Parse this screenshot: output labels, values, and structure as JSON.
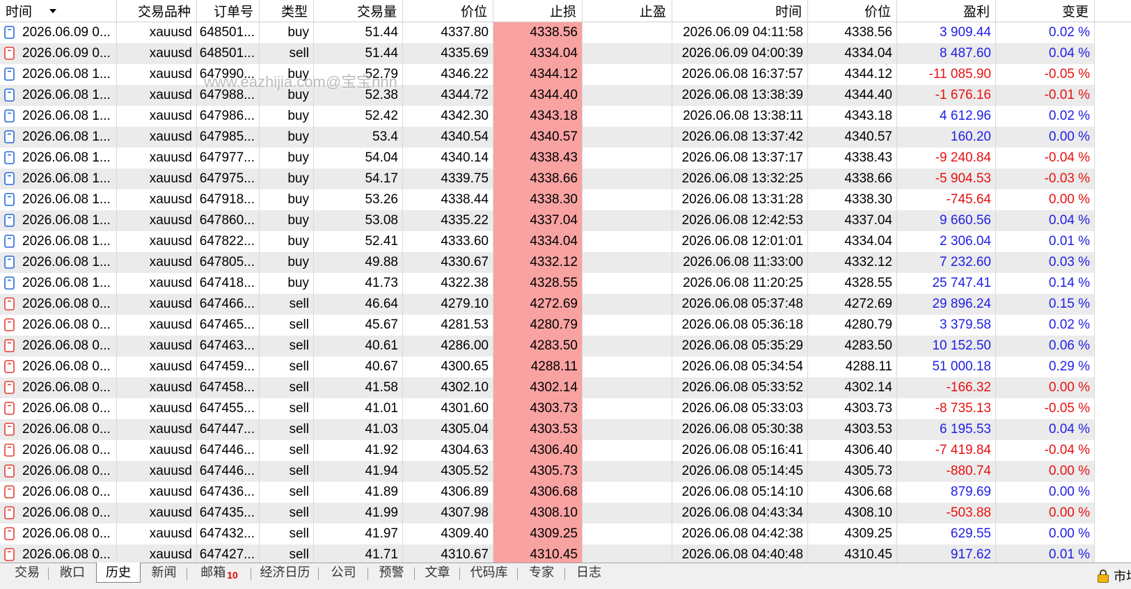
{
  "history": {
    "columns": [
      "时间",
      "交易品种",
      "订单号",
      "类型",
      "交易量",
      "价位",
      "止损",
      "止盈",
      "时间",
      "价位",
      "盈利",
      "变更"
    ],
    "sort_icon": "sort-descending-icon",
    "rows": [
      {
        "time": "2026.06.09 0...",
        "symbol": "xauusd",
        "order": "648501...",
        "type": "buy",
        "volume": "51.44",
        "price": "4337.80",
        "sl": "4338.56",
        "close_time": "2026.06.09 04:11:58",
        "close_price": "4338.56",
        "profit": "3 909.44",
        "change": "0.02 %"
      },
      {
        "time": "2026.06.09 0...",
        "symbol": "xauusd",
        "order": "648501...",
        "type": "sell",
        "volume": "51.44",
        "price": "4335.69",
        "sl": "4334.04",
        "close_time": "2026.06.09 04:00:39",
        "close_price": "4334.04",
        "profit": "8 487.60",
        "change": "0.04 %"
      },
      {
        "time": "2026.06.08 1...",
        "symbol": "xauusd",
        "order": "647990...",
        "type": "buy",
        "volume": "52.79",
        "price": "4346.22",
        "sl": "4344.12",
        "close_time": "2026.06.08 16:37:57",
        "close_price": "4344.12",
        "profit": "-11 085.90",
        "change": "-0.05 %"
      },
      {
        "time": "2026.06.08 1...",
        "symbol": "xauusd",
        "order": "647988...",
        "type": "buy",
        "volume": "52.38",
        "price": "4344.72",
        "sl": "4344.40",
        "close_time": "2026.06.08 13:38:39",
        "close_price": "4344.40",
        "profit": "-1 676.16",
        "change": "-0.01 %"
      },
      {
        "time": "2026.06.08 1...",
        "symbol": "xauusd",
        "order": "647986...",
        "type": "buy",
        "volume": "52.42",
        "price": "4342.30",
        "sl": "4343.18",
        "close_time": "2026.06.08 13:38:11",
        "close_price": "4343.18",
        "profit": "4 612.96",
        "change": "0.02 %"
      },
      {
        "time": "2026.06.08 1...",
        "symbol": "xauusd",
        "order": "647985...",
        "type": "buy",
        "volume": "53.4",
        "price": "4340.54",
        "sl": "4340.57",
        "close_time": "2026.06.08 13:37:42",
        "close_price": "4340.57",
        "profit": "160.20",
        "change": "0.00 %"
      },
      {
        "time": "2026.06.08 1...",
        "symbol": "xauusd",
        "order": "647977...",
        "type": "buy",
        "volume": "54.04",
        "price": "4340.14",
        "sl": "4338.43",
        "close_time": "2026.06.08 13:37:17",
        "close_price": "4338.43",
        "profit": "-9 240.84",
        "change": "-0.04 %"
      },
      {
        "time": "2026.06.08 1...",
        "symbol": "xauusd",
        "order": "647975...",
        "type": "buy",
        "volume": "54.17",
        "price": "4339.75",
        "sl": "4338.66",
        "close_time": "2026.06.08 13:32:25",
        "close_price": "4338.66",
        "profit": "-5 904.53",
        "change": "-0.03 %"
      },
      {
        "time": "2026.06.08 1...",
        "symbol": "xauusd",
        "order": "647918...",
        "type": "buy",
        "volume": "53.26",
        "price": "4338.44",
        "sl": "4338.30",
        "close_time": "2026.06.08 13:31:28",
        "close_price": "4338.30",
        "profit": "-745.64",
        "change": "0.00 %"
      },
      {
        "time": "2026.06.08 1...",
        "symbol": "xauusd",
        "order": "647860...",
        "type": "buy",
        "volume": "53.08",
        "price": "4335.22",
        "sl": "4337.04",
        "close_time": "2026.06.08 12:42:53",
        "close_price": "4337.04",
        "profit": "9 660.56",
        "change": "0.04 %"
      },
      {
        "time": "2026.06.08 1...",
        "symbol": "xauusd",
        "order": "647822...",
        "type": "buy",
        "volume": "52.41",
        "price": "4333.60",
        "sl": "4334.04",
        "close_time": "2026.06.08 12:01:01",
        "close_price": "4334.04",
        "profit": "2 306.04",
        "change": "0.01 %"
      },
      {
        "time": "2026.06.08 1...",
        "symbol": "xauusd",
        "order": "647805...",
        "type": "buy",
        "volume": "49.88",
        "price": "4330.67",
        "sl": "4332.12",
        "close_time": "2026.06.08 11:33:00",
        "close_price": "4332.12",
        "profit": "7 232.60",
        "change": "0.03 %"
      },
      {
        "time": "2026.06.08 1...",
        "symbol": "xauusd",
        "order": "647418...",
        "type": "buy",
        "volume": "41.73",
        "price": "4322.38",
        "sl": "4328.55",
        "close_time": "2026.06.08 11:20:25",
        "close_price": "4328.55",
        "profit": "25 747.41",
        "change": "0.14 %"
      },
      {
        "time": "2026.06.08 0...",
        "symbol": "xauusd",
        "order": "647466...",
        "type": "sell",
        "volume": "46.64",
        "price": "4279.10",
        "sl": "4272.69",
        "close_time": "2026.06.08 05:37:48",
        "close_price": "4272.69",
        "profit": "29 896.24",
        "change": "0.15 %"
      },
      {
        "time": "2026.06.08 0...",
        "symbol": "xauusd",
        "order": "647465...",
        "type": "sell",
        "volume": "45.67",
        "price": "4281.53",
        "sl": "4280.79",
        "close_time": "2026.06.08 05:36:18",
        "close_price": "4280.79",
        "profit": "3 379.58",
        "change": "0.02 %"
      },
      {
        "time": "2026.06.08 0...",
        "symbol": "xauusd",
        "order": "647463...",
        "type": "sell",
        "volume": "40.61",
        "price": "4286.00",
        "sl": "4283.50",
        "close_time": "2026.06.08 05:35:29",
        "close_price": "4283.50",
        "profit": "10 152.50",
        "change": "0.06 %"
      },
      {
        "time": "2026.06.08 0...",
        "symbol": "xauusd",
        "order": "647459...",
        "type": "sell",
        "volume": "40.67",
        "price": "4300.65",
        "sl": "4288.11",
        "close_time": "2026.06.08 05:34:54",
        "close_price": "4288.11",
        "profit": "51 000.18",
        "change": "0.29 %"
      },
      {
        "time": "2026.06.08 0...",
        "symbol": "xauusd",
        "order": "647458...",
        "type": "sell",
        "volume": "41.58",
        "price": "4302.10",
        "sl": "4302.14",
        "close_time": "2026.06.08 05:33:52",
        "close_price": "4302.14",
        "profit": "-166.32",
        "change": "0.00 %"
      },
      {
        "time": "2026.06.08 0...",
        "symbol": "xauusd",
        "order": "647455...",
        "type": "sell",
        "volume": "41.01",
        "price": "4301.60",
        "sl": "4303.73",
        "close_time": "2026.06.08 05:33:03",
        "close_price": "4303.73",
        "profit": "-8 735.13",
        "change": "-0.05 %"
      },
      {
        "time": "2026.06.08 0...",
        "symbol": "xauusd",
        "order": "647447...",
        "type": "sell",
        "volume": "41.03",
        "price": "4305.04",
        "sl": "4303.53",
        "close_time": "2026.06.08 05:30:38",
        "close_price": "4303.53",
        "profit": "6 195.53",
        "change": "0.04 %"
      },
      {
        "time": "2026.06.08 0...",
        "symbol": "xauusd",
        "order": "647446...",
        "type": "sell",
        "volume": "41.92",
        "price": "4304.63",
        "sl": "4306.40",
        "close_time": "2026.06.08 05:16:41",
        "close_price": "4306.40",
        "profit": "-7 419.84",
        "change": "-0.04 %"
      },
      {
        "time": "2026.06.08 0...",
        "symbol": "xauusd",
        "order": "647446...",
        "type": "sell",
        "volume": "41.94",
        "price": "4305.52",
        "sl": "4305.73",
        "close_time": "2026.06.08 05:14:45",
        "close_price": "4305.73",
        "profit": "-880.74",
        "change": "0.00 %"
      },
      {
        "time": "2026.06.08 0...",
        "symbol": "xauusd",
        "order": "647436...",
        "type": "sell",
        "volume": "41.89",
        "price": "4306.89",
        "sl": "4306.68",
        "close_time": "2026.06.08 05:14:10",
        "close_price": "4306.68",
        "profit": "879.69",
        "change": "0.00 %"
      },
      {
        "time": "2026.06.08 0...",
        "symbol": "xauusd",
        "order": "647435...",
        "type": "sell",
        "volume": "41.99",
        "price": "4307.98",
        "sl": "4308.10",
        "close_time": "2026.06.08 04:43:34",
        "close_price": "4308.10",
        "profit": "-503.88",
        "change": "0.00 %"
      },
      {
        "time": "2026.06.08 0...",
        "symbol": "xauusd",
        "order": "647432...",
        "type": "sell",
        "volume": "41.97",
        "price": "4309.40",
        "sl": "4309.25",
        "close_time": "2026.06.08 04:42:38",
        "close_price": "4309.25",
        "profit": "629.55",
        "change": "0.00 %"
      },
      {
        "time": "2026.06.08 0...",
        "symbol": "xauusd",
        "order": "647427...",
        "type": "sell",
        "volume": "41.71",
        "price": "4310.67",
        "sl": "4310.45",
        "close_time": "2026.06.08 04:40:48",
        "close_price": "4310.45",
        "profit": "917.62",
        "change": "0.01 %"
      }
    ]
  },
  "watermark": "www.eazhijia.com@宝宝nnn",
  "tabs": [
    {
      "label": "交易"
    },
    {
      "label": "敞口"
    },
    {
      "label": "历史",
      "active": true
    },
    {
      "label": "新闻"
    },
    {
      "label": "邮箱",
      "badge": "10"
    },
    {
      "label": "经济日历"
    },
    {
      "label": "公司"
    },
    {
      "label": "预警"
    },
    {
      "label": "文章"
    },
    {
      "label": "代码库"
    },
    {
      "label": "专家"
    },
    {
      "label": "日志"
    }
  ],
  "market_tab": {
    "label": "市场",
    "icon": "lock-icon"
  },
  "icons": {
    "buy": "buy-order-icon",
    "sell": "sell-order-icon"
  },
  "colors": {
    "profit_positive": "#1e1ee6",
    "profit_negative": "#e81010",
    "buy_icon": "#2268d8",
    "sell_icon": "#e63b33",
    "stop_loss_bg": "#f9a2a2",
    "row_alt_bg": "#ebebeb",
    "badge": "#e00000",
    "lock": "#f2b50f"
  }
}
